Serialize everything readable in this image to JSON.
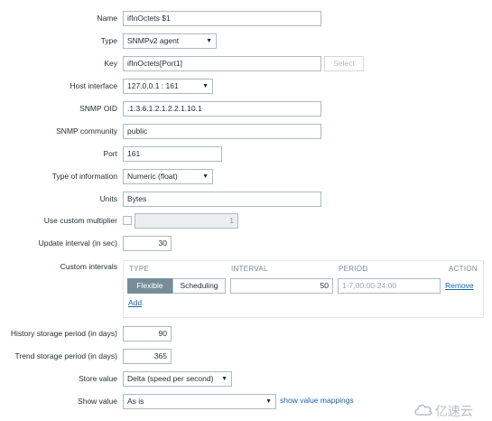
{
  "fields": {
    "name": {
      "label": "Name",
      "value": "ifInOctets $1"
    },
    "type": {
      "label": "Type",
      "value": "SNMPv2 agent"
    },
    "key": {
      "label": "Key",
      "value": "ifInOctets[Port1]",
      "select_label": "Select"
    },
    "host_interface": {
      "label": "Host interface",
      "value": "127.0.0.1 : 161"
    },
    "snmp_oid": {
      "label": "SNMP OID",
      "value": ".1.3.6.1.2.1.2.2.1.10.1"
    },
    "snmp_community": {
      "label": "SNMP community",
      "value": "public"
    },
    "port": {
      "label": "Port",
      "value": "161"
    },
    "type_of_information": {
      "label": "Type of information",
      "value": "Numeric (float)"
    },
    "units": {
      "label": "Units",
      "value": "Bytes"
    },
    "custom_multiplier": {
      "label": "Use custom multiplier",
      "value": "1",
      "checked": false
    },
    "update_interval": {
      "label": "Update interval (in sec)",
      "value": "30"
    },
    "custom_intervals": {
      "label": "Custom intervals",
      "headers": {
        "type": "TYPE",
        "interval": "INTERVAL",
        "period": "PERIOD",
        "action": "ACTION"
      },
      "row": {
        "flexible": "Flexible",
        "scheduling": "Scheduling",
        "interval": "50",
        "period_placeholder": "1-7,00:00-24:00",
        "remove": "Remove"
      },
      "add": "Add"
    },
    "history": {
      "label": "History storage period (in days)",
      "value": "90"
    },
    "trend": {
      "label": "Trend storage period (in days)",
      "value": "365"
    },
    "store_value": {
      "label": "Store value",
      "value": "Delta (speed per second)"
    },
    "show_value": {
      "label": "Show value",
      "value": "As is",
      "mappings_link": "show value mappings"
    }
  },
  "watermark": {
    "text": "亿速云"
  },
  "colors": {
    "accent": "#768d99",
    "link": "#1a64a8",
    "border": "#acbbc2"
  }
}
